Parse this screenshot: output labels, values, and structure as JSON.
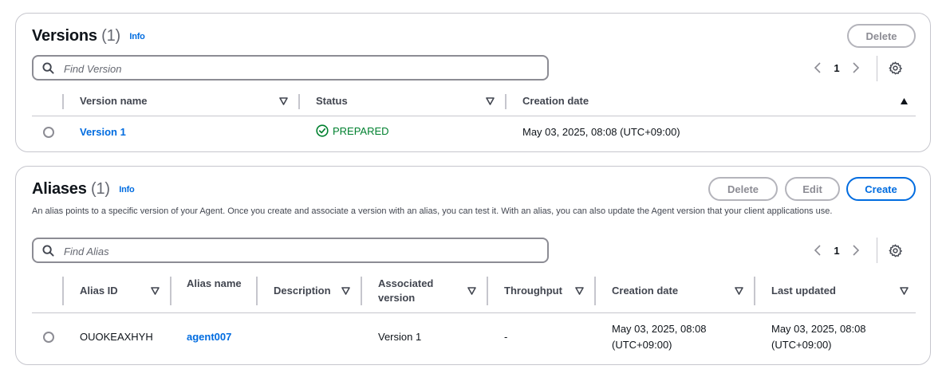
{
  "versions": {
    "title": "Versions",
    "count": "(1)",
    "info": "Info",
    "delete_label": "Delete",
    "search_placeholder": "Find Version",
    "page": "1",
    "columns": [
      "Version name",
      "Status",
      "Creation date"
    ],
    "rows": [
      {
        "name": "Version 1",
        "status": "PREPARED",
        "created": "May 03, 2025, 08:08 (UTC+09:00)"
      }
    ]
  },
  "aliases": {
    "title": "Aliases",
    "count": "(1)",
    "info": "Info",
    "delete_label": "Delete",
    "edit_label": "Edit",
    "create_label": "Create",
    "description": "An alias points to a specific version of your Agent. Once you create and associate a version with an alias, you can test it. With an alias, you can also update the Agent version that your client applications use.",
    "search_placeholder": "Find Alias",
    "page": "1",
    "columns": [
      "Alias ID",
      "Alias name",
      "Description",
      "Associated version",
      "Throughput",
      "Creation date",
      "Last updated"
    ],
    "rows": [
      {
        "id": "OUOKEAXHYH",
        "name": "agent007",
        "description": "",
        "version": "Version 1",
        "throughput": "-",
        "created": "May 03, 2025, 08:08 (UTC+09:00)",
        "updated": "May 03, 2025, 08:08 (UTC+09:00)"
      }
    ]
  },
  "colors": {
    "link": "#006ce0",
    "success": "#00802f",
    "border": "#c6c6cd"
  }
}
